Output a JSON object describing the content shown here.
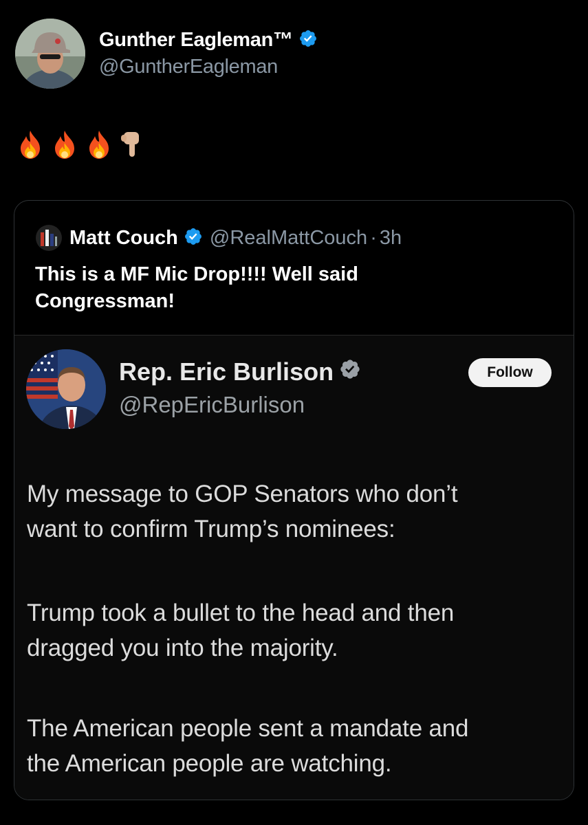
{
  "author": {
    "display_name": "Gunther Eagleman™",
    "handle": "@GuntherEagleman"
  },
  "post": {
    "emoji": [
      "fire",
      "fire",
      "fire",
      "backhand-index-pointing-down"
    ]
  },
  "quoted": {
    "display_name": "Matt Couch",
    "handle": "@RealMattCouch",
    "separator": "·",
    "time": "3h",
    "text_line1": "This is a MF Mic Drop!!!! Well said",
    "text_line2": "Congressman!"
  },
  "embedded": {
    "display_name": "Rep. Eric Burlison",
    "handle": "@RepEricBurlison",
    "follow_label": "Follow",
    "paragraphs": [
      [
        "My message to GOP Senators who don’t",
        "want to confirm Trump’s nominees:"
      ],
      [
        "Trump took a bullet to the head and then",
        "dragged you into the majority."
      ],
      [
        "The American people sent a mandate and",
        "the American people are watching."
      ]
    ]
  },
  "colors": {
    "background": "#000000",
    "verified_blue": "#1d9bf0",
    "secondary_text": "#8b98a5"
  }
}
